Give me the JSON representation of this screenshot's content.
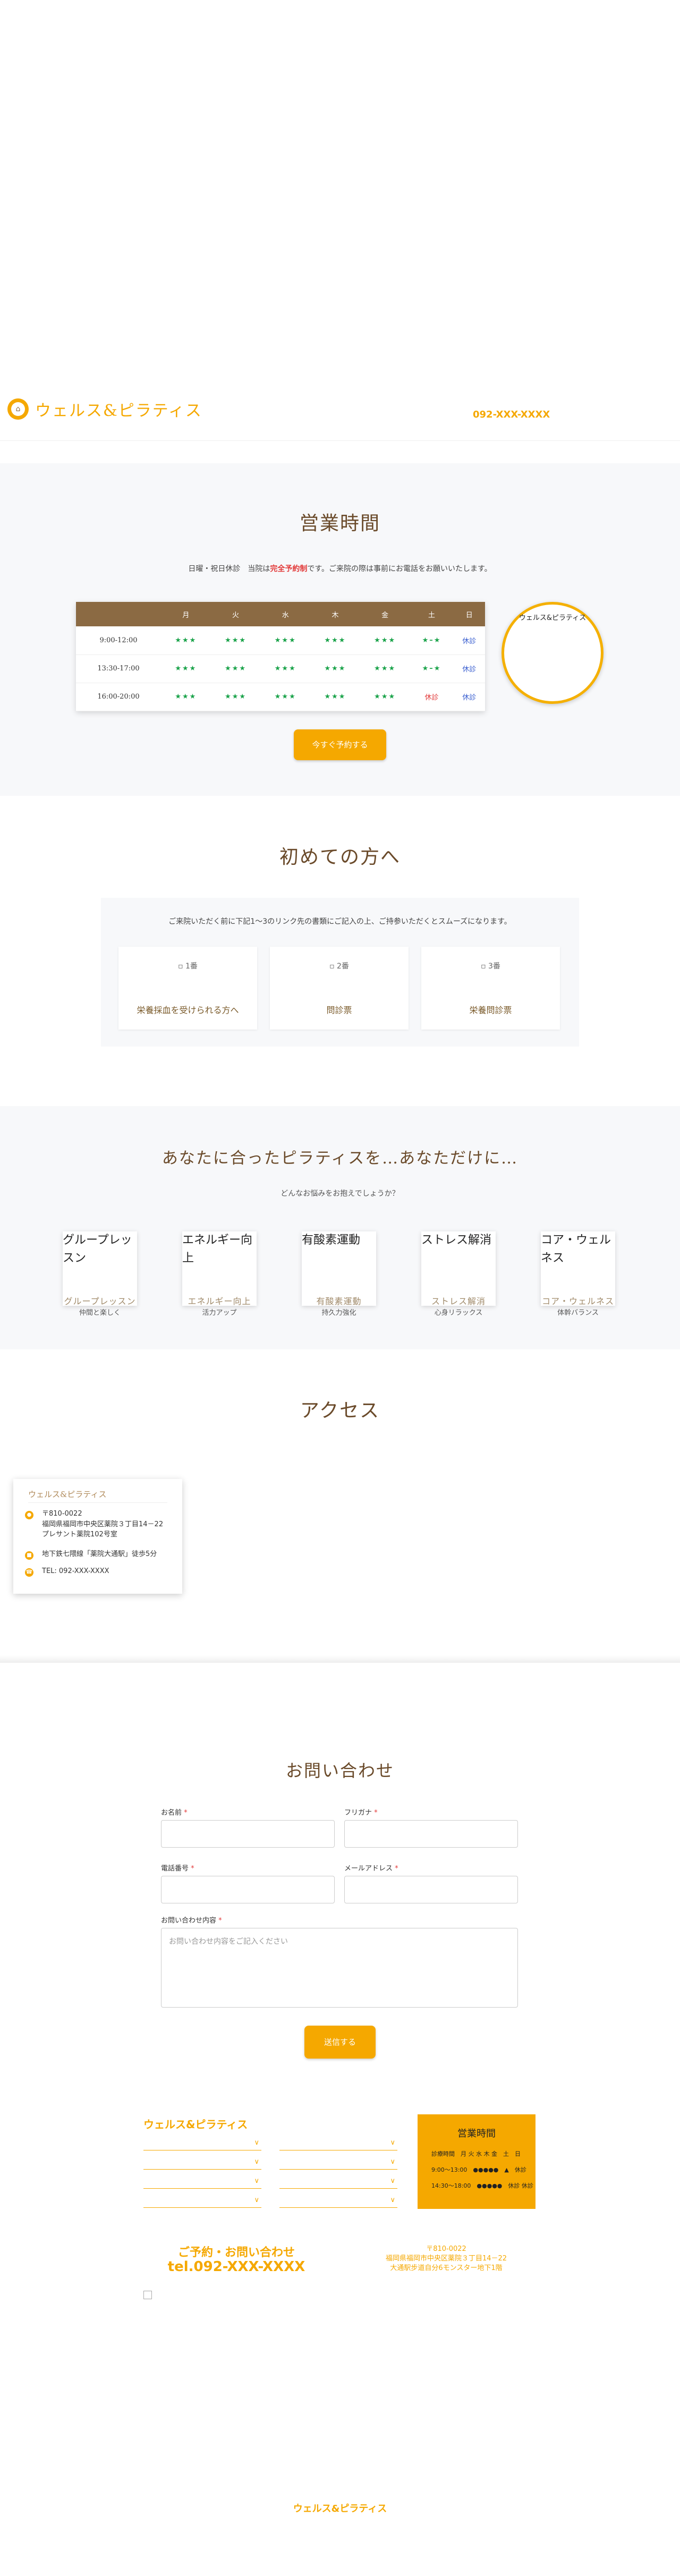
{
  "header": {
    "brand": "ウェルス&ピラティス",
    "tel": "092-XXX-XXXX"
  },
  "hours": {
    "title": "営業時間",
    "note_prefix": "日曜・祝日休診　当院は",
    "note_highlight": "完全予約制",
    "note_suffix": "です。ご来院の際は事前にお電話をお願いいたします。",
    "days": [
      "月",
      "火",
      "水",
      "木",
      "金",
      "土",
      "日"
    ],
    "rows": [
      {
        "time": "9:00-12:00",
        "cells": [
          "★★★",
          "★★★",
          "★★★",
          "★★★",
          "★★★",
          "★–★",
          "休診"
        ]
      },
      {
        "time": "13:30-17:00",
        "cells": [
          "★★★",
          "★★★",
          "★★★",
          "★★★",
          "★★★",
          "★–★",
          "休診"
        ]
      },
      {
        "time": "16:00-20:00",
        "cells": [
          "★★★",
          "★★★",
          "★★★",
          "★★★",
          "★★★",
          "休診",
          "休診"
        ]
      }
    ],
    "circle_label": "ウェルス&ピラティス",
    "reserve_button": "今すぐ予約する"
  },
  "first": {
    "title": "初めての方へ",
    "note": "ご来院いただく前に下記1～3のリンク先の書類にご記入の上、ご持参いただくとスムーズになります。",
    "steps": [
      {
        "img_alt": "1番",
        "label": "栄養採血を受けられる方へ"
      },
      {
        "img_alt": "2番",
        "label": "問診票"
      },
      {
        "img_alt": "3番",
        "label": "栄養問診票"
      }
    ]
  },
  "pilates": {
    "title": "あなたに合ったピラティスを…あなただけに…",
    "subtitle": "どんなお悩みをお抱えでしょうか？",
    "items": [
      {
        "img_alt": "グループレッスン",
        "name": "グループレッスン",
        "sub": "仲間と楽しく"
      },
      {
        "img_alt": "エネルギー向上",
        "name": "エネルギー向上",
        "sub": "活力アップ"
      },
      {
        "img_alt": "有酸素運動",
        "name": "有酸素運動",
        "sub": "持久力強化"
      },
      {
        "img_alt": "ストレス解消",
        "name": "ストレス解消",
        "sub": "心身リラックス"
      },
      {
        "img_alt": "コア・ウェルネス",
        "name": "コア・ウェルネス",
        "sub": "体幹バランス"
      }
    ]
  },
  "access": {
    "title": "アクセス",
    "card_title": "ウェルス&ピラティス",
    "zip": "〒810-0022",
    "address1": "福岡県福岡市中央区薬院３丁目14－22",
    "address2": "プレサント薬院102号室",
    "train": "地下鉄七隈線「薬院大通駅」徒歩5分",
    "tel": "TEL: 092-XXX-XXXX"
  },
  "contact": {
    "title": "お問い合わせ",
    "name_label": "お名前",
    "kana_label": "フリガナ",
    "phone_label": "電話番号",
    "email_label": "メールアドレス",
    "message_label": "お問い合わせ内容",
    "required_mark": "*",
    "message_placeholder": "お問い合わせ内容をご記入ください",
    "submit": "送信する"
  },
  "footer": {
    "brand": "ウェルス&ピラティス",
    "hours_title": "営業時間",
    "hours_header": "診療時間　月 火 水 木 金　土　日",
    "hours_row1": "9:00～13:00　●●●●●　▲　休診",
    "hours_row2": "14:30～18:00　●●●●●　休診 休診",
    "tel_label": "ご予約・お問い合わせ",
    "tel": "tel.092-XXX-XXXX",
    "addr_zip": "〒810-0022",
    "addr1": "福岡県福岡市中央区薬院３丁目14－22",
    "addr2": "大通駅步道自分6モンスター地下1階",
    "bottom_brand": "ウェルス&ピラティス"
  }
}
